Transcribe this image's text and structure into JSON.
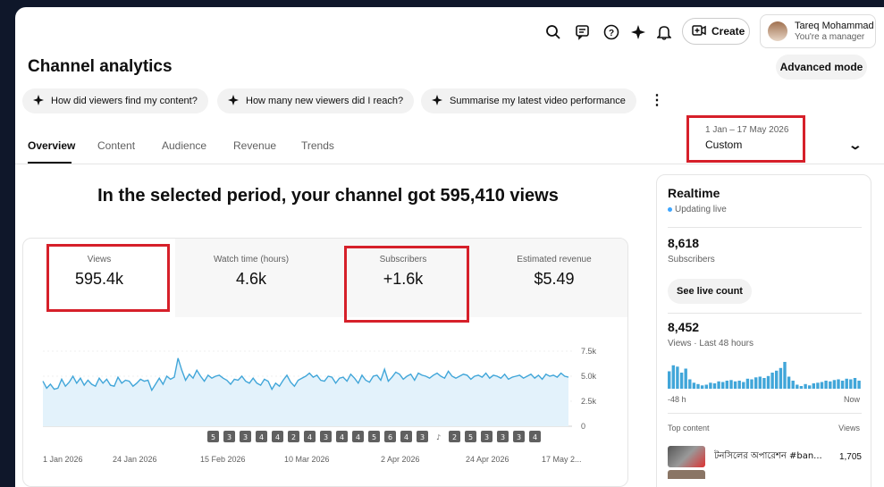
{
  "header": {
    "create_label": "Create",
    "account_name": "Tareq Mohammad",
    "account_role": "You're a manager",
    "icons": [
      "search-icon",
      "feedback-icon",
      "help-icon",
      "sparkle-icon",
      "bell-icon",
      "create-video-icon"
    ]
  },
  "page": {
    "title": "Channel analytics",
    "advanced_mode_label": "Advanced mode"
  },
  "chips": [
    {
      "label": "How did viewers find my content?"
    },
    {
      "label": "How many new viewers did I reach?"
    },
    {
      "label": "Summarise my latest video performance"
    }
  ],
  "tabs": [
    {
      "label": "Overview",
      "active": true
    },
    {
      "label": "Content"
    },
    {
      "label": "Audience"
    },
    {
      "label": "Revenue"
    },
    {
      "label": "Trends"
    }
  ],
  "date_selector": {
    "range": "1 Jan – 17 May 2026",
    "label": "Custom"
  },
  "headline": "In the selected period, your channel got 595,410 views",
  "metrics": [
    {
      "label": "Views",
      "value": "595.4k"
    },
    {
      "label": "Watch time (hours)",
      "value": "4.6k"
    },
    {
      "label": "Subscribers",
      "value": "+1.6k"
    },
    {
      "label": "Estimated revenue",
      "value": "$5.49"
    }
  ],
  "colors": {
    "accent": "#3ea6ff",
    "line": "#41a6d9",
    "area": "#e3f2fb",
    "highlight": "#d6202a"
  },
  "chart_data": {
    "type": "area",
    "x_labels": [
      "1 Jan 2026",
      "24 Jan 2026",
      "15 Feb 2026",
      "10 Mar 2026",
      "2 Apr 2026",
      "24 Apr 2026",
      "17 May 2..."
    ],
    "y_ticks": [
      "7.5k",
      "5.0k",
      "2.5k",
      "0"
    ],
    "ylim": [
      0,
      7500
    ],
    "values": [
      4500,
      3800,
      4200,
      3700,
      3800,
      4700,
      4000,
      4400,
      5000,
      4300,
      4800,
      4100,
      4600,
      4200,
      4000,
      4800,
      4300,
      4700,
      4100,
      4000,
      4900,
      4300,
      4600,
      4500,
      4000,
      4300,
      4700,
      4500,
      4600,
      3600,
      4200,
      4800,
      4200,
      5000,
      4700,
      4900,
      6800,
      5600,
      4600,
      5200,
      4800,
      5600,
      5000,
      4500,
      5100,
      4800,
      5000,
      5100,
      4800,
      4600,
      4200,
      4700,
      4600,
      5000,
      4500,
      4300,
      4800,
      4300,
      4100,
      4700,
      4500,
      3700,
      4300,
      4000,
      4600,
      5100,
      4400,
      4000,
      4600,
      4800,
      5000,
      5300,
      4900,
      5100,
      4600,
      4500,
      5000,
      4900,
      4300,
      4800,
      4900,
      4500,
      5200,
      4800,
      4300,
      5100,
      4600,
      4400,
      5000,
      5100,
      4600,
      5700,
      4500,
      4900,
      5400,
      5200,
      4700,
      5000,
      5200,
      4600,
      5300,
      5100,
      5000,
      4800,
      5100,
      5300,
      5000,
      4800,
      5500,
      5000,
      4800,
      5000,
      5200,
      5100,
      4700,
      5000,
      5100,
      4900,
      5300,
      4800,
      5100,
      5000,
      4800,
      5200,
      4700,
      4900,
      5000,
      5100,
      4800,
      5000,
      5200,
      4800,
      5100,
      4700,
      5200,
      5000,
      5100,
      4900,
      5300,
      5000,
      4900
    ],
    "markers": [
      "5",
      "3",
      "3",
      "4",
      "4",
      "2",
      "4",
      "3",
      "4",
      "4",
      "5",
      "6",
      "4",
      "3",
      "♪",
      "2",
      "5",
      "3",
      "3",
      "3",
      "4"
    ]
  },
  "realtime": {
    "title": "Realtime",
    "status": "Updating live",
    "subscribers_value": "8,618",
    "subscribers_label": "Subscribers",
    "live_count_label": "See live count",
    "views_value": "8,452",
    "views_label": "Views · Last 48 hours",
    "axis_start": "-48 h",
    "axis_end": "Now",
    "top_content_label": "Top content",
    "views_col_label": "Views",
    "hourly_views": [
      130,
      175,
      165,
      120,
      150,
      70,
      45,
      35,
      25,
      30,
      45,
      40,
      55,
      50,
      60,
      65,
      55,
      60,
      50,
      75,
      70,
      85,
      90,
      80,
      95,
      120,
      135,
      155,
      200,
      90,
      60,
      30,
      20,
      35,
      25,
      40,
      45,
      50,
      60,
      55,
      65,
      70,
      60,
      75,
      70,
      80,
      60
    ],
    "top_items": [
      {
        "title": "টনসিলের অপারেশন #ban...",
        "views": "1,705"
      }
    ]
  }
}
